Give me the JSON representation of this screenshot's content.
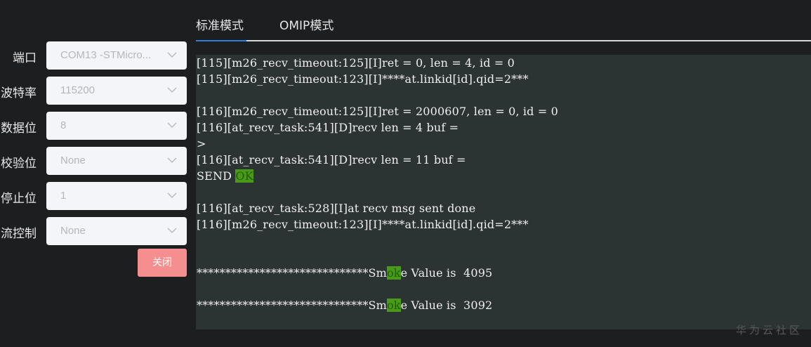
{
  "tabs": [
    {
      "label": "标准模式"
    },
    {
      "label": "OMIP模式"
    }
  ],
  "settings": [
    {
      "label": "端口",
      "value": "COM13 -STMicro..."
    },
    {
      "label": "波特率",
      "value": "115200"
    },
    {
      "label": "数据位",
      "value": "8"
    },
    {
      "label": "校验位",
      "value": "None"
    },
    {
      "label": "停止位",
      "value": "1"
    },
    {
      "label": "流控制",
      "value": "None"
    }
  ],
  "close_button": "关闭",
  "terminal": {
    "lines": [
      {
        "pre": "[115][m26_recv_timeout:125][I]ret = 0, len = 4, id = 0",
        "hl": "",
        "post": ""
      },
      {
        "pre": "[115][m26_recv_timeout:123][I]****at.linkid[id].qid=2***",
        "hl": "",
        "post": ""
      },
      {
        "pre": "",
        "hl": "",
        "post": ""
      },
      {
        "pre": "[116][m26_recv_timeout:125][I]ret = 2000607, len = 0, id = 0",
        "hl": "",
        "post": ""
      },
      {
        "pre": "[116][at_recv_task:541][D]recv len = 4 buf =",
        "hl": "",
        "post": ""
      },
      {
        "pre": ">",
        "hl": "",
        "post": ""
      },
      {
        "pre": "[116][at_recv_task:541][D]recv len = 11 buf =",
        "hl": "",
        "post": ""
      },
      {
        "pre": "SEND ",
        "hl": "OK",
        "post": ""
      },
      {
        "pre": "",
        "hl": "",
        "post": ""
      },
      {
        "pre": "[116][at_recv_task:528][I]at recv msg sent done",
        "hl": "",
        "post": ""
      },
      {
        "pre": "[116][m26_recv_timeout:123][I]****at.linkid[id].qid=2***",
        "hl": "",
        "post": ""
      },
      {
        "pre": "",
        "hl": "",
        "post": ""
      },
      {
        "pre": "",
        "hl": "",
        "post": ""
      },
      {
        "pre": "******************************Sm",
        "hl": "ok",
        "post": "e Value is  4095"
      },
      {
        "pre": "",
        "hl": "",
        "post": ""
      },
      {
        "pre": "******************************Sm",
        "hl": "ok",
        "post": "e Value is  3092"
      }
    ]
  },
  "watermark": "华为云社区"
}
